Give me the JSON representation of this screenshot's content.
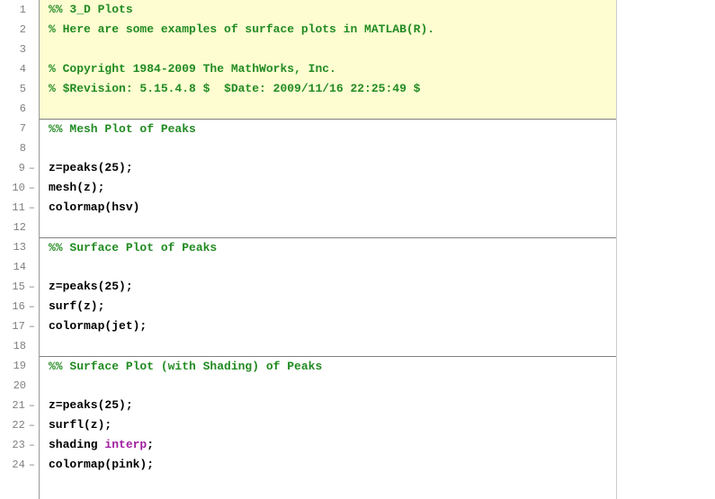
{
  "gutter": {
    "1": {
      "num": "1",
      "dash": ""
    },
    "2": {
      "num": "2",
      "dash": ""
    },
    "3": {
      "num": "3",
      "dash": ""
    },
    "4": {
      "num": "4",
      "dash": ""
    },
    "5": {
      "num": "5",
      "dash": ""
    },
    "6": {
      "num": "6",
      "dash": ""
    },
    "7": {
      "num": "7",
      "dash": ""
    },
    "8": {
      "num": "8",
      "dash": ""
    },
    "9": {
      "num": "9",
      "dash": "–"
    },
    "10": {
      "num": "10",
      "dash": "–"
    },
    "11": {
      "num": "11",
      "dash": "–"
    },
    "12": {
      "num": "12",
      "dash": ""
    },
    "13": {
      "num": "13",
      "dash": ""
    },
    "14": {
      "num": "14",
      "dash": ""
    },
    "15": {
      "num": "15",
      "dash": "–"
    },
    "16": {
      "num": "16",
      "dash": "–"
    },
    "17": {
      "num": "17",
      "dash": "–"
    },
    "18": {
      "num": "18",
      "dash": ""
    },
    "19": {
      "num": "19",
      "dash": ""
    },
    "20": {
      "num": "20",
      "dash": ""
    },
    "21": {
      "num": "21",
      "dash": "–"
    },
    "22": {
      "num": "22",
      "dash": "–"
    },
    "23": {
      "num": "23",
      "dash": "–"
    },
    "24": {
      "num": "24",
      "dash": "–"
    }
  },
  "lines": {
    "l1": {
      "comment": "%% 3_D Plots"
    },
    "l2": {
      "comment": "% Here are some examples of surface plots in MATLAB(R)."
    },
    "l3": {
      "comment": ""
    },
    "l4": {
      "comment": "% Copyright 1984-2009 The MathWorks, Inc."
    },
    "l5": {
      "comment": "% $Revision: 5.15.4.8 $  $Date: 2009/11/16 22:25:49 $"
    },
    "l6": {
      "comment": ""
    },
    "l7": {
      "comment": "%% Mesh Plot of Peaks"
    },
    "l8": {
      "plain": ""
    },
    "l9": {
      "plain": "z=peaks(25);"
    },
    "l10": {
      "plain": "mesh(z);"
    },
    "l11": {
      "plain": "colormap(hsv)"
    },
    "l12": {
      "plain": ""
    },
    "l13": {
      "comment": "%% Surface Plot of Peaks"
    },
    "l14": {
      "plain": ""
    },
    "l15": {
      "plain": "z=peaks(25);"
    },
    "l16": {
      "plain": "surf(z);"
    },
    "l17": {
      "plain": "colormap(jet);"
    },
    "l18": {
      "plain": ""
    },
    "l19": {
      "comment": "%% Surface Plot (with Shading) of Peaks"
    },
    "l20": {
      "plain": ""
    },
    "l21": {
      "plain": "z=peaks(25);"
    },
    "l22": {
      "plain": "surfl(z);"
    },
    "l23": {
      "pre": "shading ",
      "kw": "interp",
      "post": ";"
    },
    "l24": {
      "plain": "colormap(pink);"
    }
  }
}
